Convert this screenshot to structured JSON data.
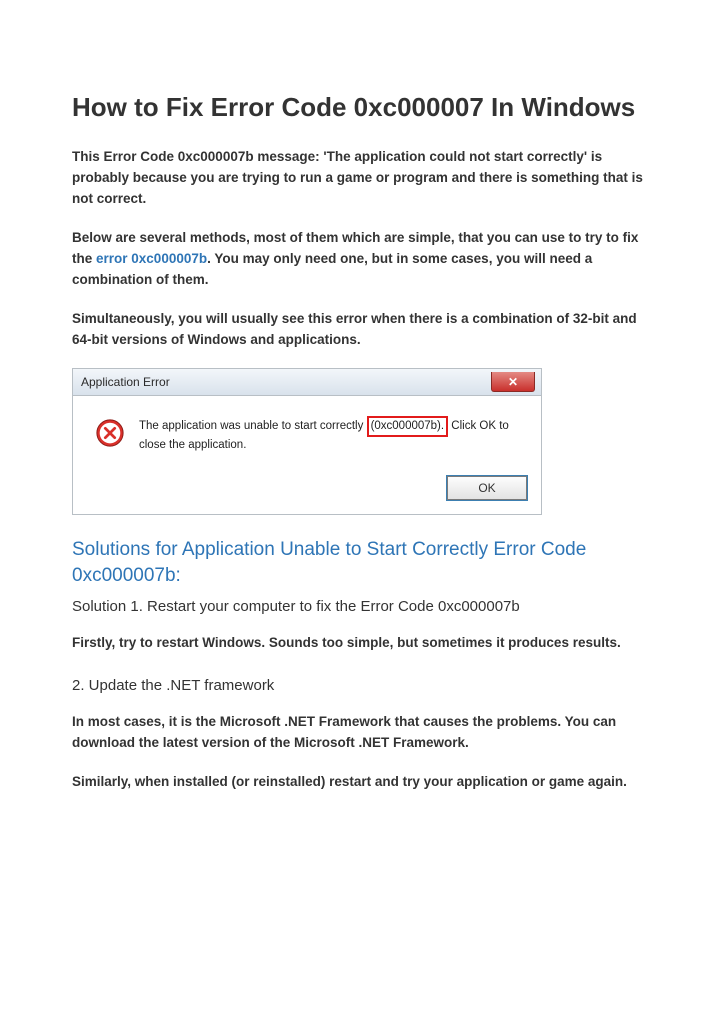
{
  "title": "How to Fix Error Code 0xc000007 In Windows",
  "p1": "This  Error Code 0xc000007b message: 'The application could not start correctly' is probably because you are trying to run a game or program and there is something that is not correct.",
  "p2_a": "Below are several methods, most of them which are simple, that you can use to try to fix the ",
  "p2_link": "error 0xc000007b",
  "p2_b": ". You may only need one, but in some cases, you will need a combination of them.",
  "p3": "Simultaneously, you will usually see this error when there is a combination of 32-bit and 64-bit versions of Windows and applications.",
  "dialog": {
    "title": "Application Error",
    "msg_a": "The application was unable to start correctly ",
    "msg_hl": "(0xc000007b).",
    "msg_b": " Click OK to close the application.",
    "ok": "OK"
  },
  "h2": "Solutions for Application Unable to Start Correctly Error Code 0xc000007b:",
  "sol1_title": "Solution 1. Restart your computer to fix the Error Code 0xc000007b",
  "sol1_body": "Firstly, try to restart Windows. Sounds too simple, but sometimes it produces results.",
  "sol2_title": "2. Update the .NET framework",
  "sol2_body1": "In most cases, it is the Microsoft .NET Framework that causes the problems. You can download the latest version of the Microsoft .NET Framework.",
  "sol2_body2": "Similarly, when installed (or reinstalled) restart and try your application or game again."
}
